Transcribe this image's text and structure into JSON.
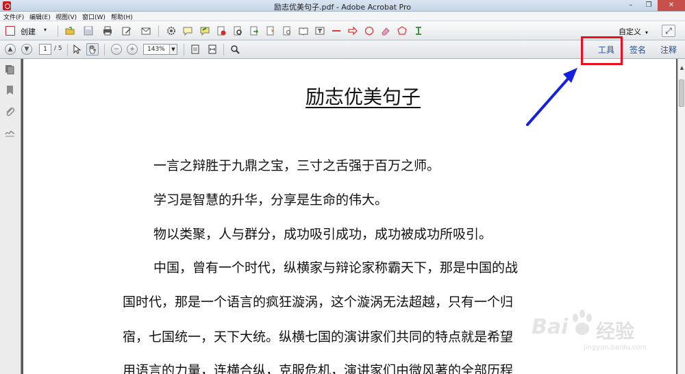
{
  "window": {
    "title": "励志优美句子.pdf - Adobe Acrobat Pro",
    "minimize_glyph": "–",
    "maximize_glyph": "❐",
    "close_glyph": "✕"
  },
  "menu": {
    "items": [
      "文件(F)",
      "编辑(E)",
      "视图(V)",
      "窗口(W)",
      "帮助(H)"
    ]
  },
  "toolbar": {
    "create_label": "创建",
    "customize_label": "自定义",
    "icons": [
      "open-folder-icon",
      "save-icon",
      "print-icon",
      "edit-icon",
      "email-icon",
      "settings-icon",
      "comment-icon",
      "highlight-icon",
      "delete-page-icon",
      "stamp-icon",
      "export-icon",
      "form-icon",
      "link-icon",
      "book-icon",
      "text-box-icon",
      "line-icon",
      "arrow-icon",
      "circle-icon",
      "eraser-icon",
      "polygon-icon",
      "text-field-icon"
    ]
  },
  "nav": {
    "current_page": "1",
    "total_pages": "/ 5",
    "zoom": "143%"
  },
  "pane_tabs": [
    "工具",
    "签名",
    "注释"
  ],
  "document": {
    "title": "励志优美句子",
    "lines": [
      "一言之辩胜于九鼎之宝，三寸之舌强于百万之师。",
      "学习是智慧的升华，分享是生命的伟大。",
      "物以类聚，人与群分，成功吸引成功，成功被成功所吸引。",
      "中国，曾有一个时代，纵横家与辩论家称霸天下，那是中国的战",
      "国时代，那是一个语言的疯狂漩涡，这个漩涡无法超越，只有一个归",
      "宿，七国统一，天下大统。纵横七国的演讲家们共同的特点就是希望",
      "用语言的力量，连横合纵，克服危机，演讲家们由微风著的全部历程"
    ]
  },
  "watermark": {
    "brand": "Bai",
    "text": "经验",
    "url": "jingyan.baidu.com"
  },
  "colors": {
    "highlight": "#e8101a",
    "annotation_arrow": "#1620e0",
    "link_blue": "#1f4f9f"
  }
}
